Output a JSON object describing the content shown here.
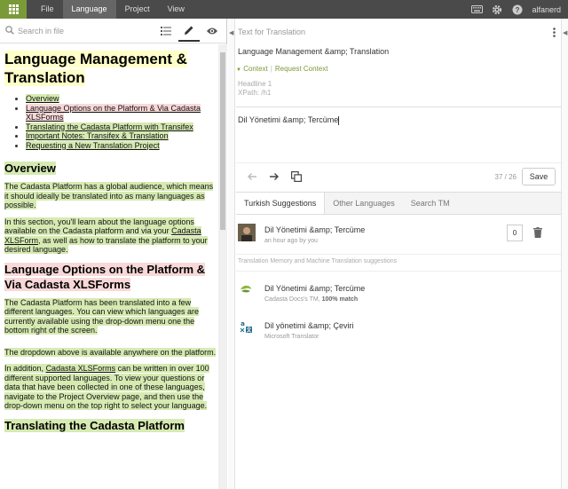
{
  "topbar": {
    "menu": [
      "File",
      "Language",
      "Project",
      "View"
    ],
    "active_menu": "Language",
    "user": "alfanerd"
  },
  "left": {
    "search_placeholder": "Search in file",
    "document": {
      "title": "Language Management & Translation",
      "toc": [
        "Overview",
        "Language Options on the Platform & Via Cadasta XLSForms",
        "Translating the Cadasta Platform with Transifex",
        "Important Notes: Transifex & Translation",
        "Requesting a New Translation Project"
      ],
      "overview_heading": "Overview",
      "overview_p1": "The Cadasta Platform has a global audience, which means it should ideally be translated into as many languages as possible.",
      "overview_p2_a": "In this section, you'll learn about the language options available on the Cadasta platform and via your",
      "overview_p2_link": "Cadasta XLSForm",
      "overview_p2_b": ", as well as how to translate the platform to your desired language.",
      "options_heading": "Language Options on the Platform & Via Cadasta XLSForms",
      "options_p1": "The Cadasta Platform has been translated into a few different languages. You can view which languages are currently available using the drop-down menu one the bottom right of the screen.",
      "options_p2": "The dropdown above is available anywhere on the platform.",
      "options_p3_a": "In addition,",
      "options_p3_link": "Cadasta XLSForms",
      "options_p3_b": "can be written in over 100 different supported languages. To view your questions or data that have been collected in one of these languages, navigate to the Project Overview page, and then use the drop-down menu on the top right to select your language.",
      "translating_heading": "Translating the Cadasta Platform"
    }
  },
  "right": {
    "section_label": "Text for Translation",
    "source_text": "Language Management &amp; Translation",
    "context_label": "Context",
    "request_context_label": "Request Context",
    "meta_headline": "Headline 1",
    "meta_xpath": "XPath: /h1",
    "translation_text": "Dil Yönetimi &amp; Tercüme",
    "counter": "37 / 26",
    "save_label": "Save",
    "tabs": [
      "Turkish Suggestions",
      "Other Languages",
      "Search TM"
    ],
    "active_tab": "Turkish Suggestions",
    "suggestion": {
      "text": "Dil Yönetimi &amp; Tercüme",
      "meta": "an hour ago by you",
      "votes": "0"
    },
    "tm_label": "Translation Memory and Machine Translation suggestions",
    "tm": [
      {
        "text": "Dil Yönetimi &amp; Tercüme",
        "source": "Cadasta Docs's TM, ",
        "match": "100% match",
        "icon": "cadasta-tm-icon"
      },
      {
        "text": "Dil yönetimi &amp; Çeviri",
        "source": "Microsoft Translator",
        "match": "",
        "icon": "microsoft-translator-icon"
      }
    ]
  },
  "colors": {
    "topbar": "#4a4a4a",
    "apps_button": "#7a9a38",
    "highlight_yellow": "#ffffc8",
    "highlight_green": "#d6eab2",
    "highlight_red": "#f8d8d8",
    "accent": "#7a9a38"
  }
}
